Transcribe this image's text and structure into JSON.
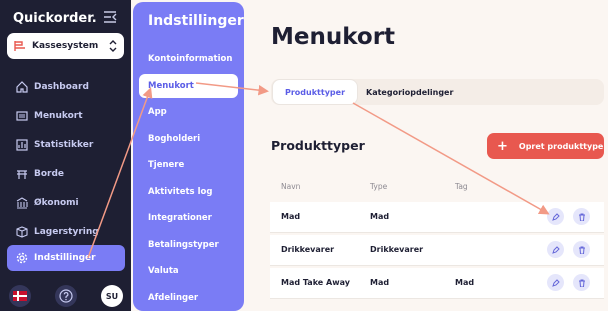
{
  "app": {
    "brand": "Quickorder."
  },
  "system_select": {
    "value": "Kassesystem"
  },
  "sidebar": {
    "items": [
      {
        "label": "Dashboard",
        "icon": "home-icon"
      },
      {
        "label": "Menukort",
        "icon": "menu-card-icon"
      },
      {
        "label": "Statistikker",
        "icon": "chart-icon"
      },
      {
        "label": "Borde",
        "icon": "table-icon"
      },
      {
        "label": "Økonomi",
        "icon": "bank-icon"
      },
      {
        "label": "Lagerstyring",
        "icon": "box-icon"
      }
    ],
    "active_label": "Indstillinger"
  },
  "footer": {
    "avatar_initials": "SU"
  },
  "settings": {
    "title": "Indstillinger",
    "items": [
      "Kontoinformation",
      "Menukort",
      "App",
      "Bogholderi",
      "Tjenere",
      "Aktivitets log",
      "Integrationer",
      "Betalingstyper",
      "Valuta",
      "Afdelinger"
    ],
    "active_index": 1
  },
  "main": {
    "title": "Menukort",
    "tabs": [
      "Produkttyper",
      "Kategoriopdelinger"
    ],
    "section_title": "Produkttyper",
    "create_label": "Opret produkttype",
    "columns": [
      "Navn",
      "Type",
      "Tag"
    ],
    "rows": [
      {
        "name": "Mad",
        "type": "Mad",
        "tag": ""
      },
      {
        "name": "Drikkevarer",
        "type": "Drikkevarer",
        "tag": ""
      },
      {
        "name": "Mad Take Away",
        "type": "Mad",
        "tag": "Mad"
      }
    ]
  },
  "colors": {
    "sidebar_bg": "#1e1f33",
    "accent": "#7a7cf5",
    "primary_button": "#e8584f",
    "annotation_arrow": "#f29a86"
  }
}
